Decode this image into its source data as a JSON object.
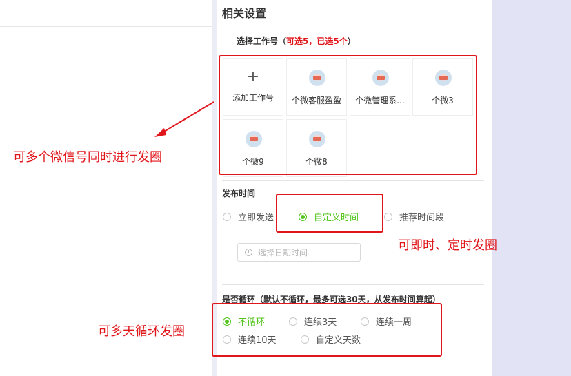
{
  "panel": {
    "title": "相关设置",
    "select_label_prefix": "选择工作号（",
    "select_label_red": "可选5，已选5个",
    "select_label_suffix": "）",
    "add_tile_label": "添加工作号",
    "tiles": [
      "个微客服盈盈",
      "个微管理系...",
      "个微3",
      "个微9",
      "个微8"
    ]
  },
  "publish": {
    "label": "发布时间",
    "options": [
      "立即发送",
      "自定义时间",
      "推荐时间段"
    ],
    "selected": "自定义时间",
    "date_placeholder": "选择日期时间"
  },
  "loop": {
    "label": "是否循环（默认不循环，最多可选30天，从发布时间算起）",
    "options": [
      "不循环",
      "连续3天",
      "连续一周",
      "连续10天",
      "自定义天数"
    ],
    "selected": "不循环"
  },
  "annotations": {
    "multi_account": "可多个微信号同时进行发圈",
    "timing": "可即时、定时发圈",
    "loop": "可多天循环发圈"
  },
  "colors": {
    "accent_green": "#52c41a",
    "annotation_red": "#e0161b"
  }
}
